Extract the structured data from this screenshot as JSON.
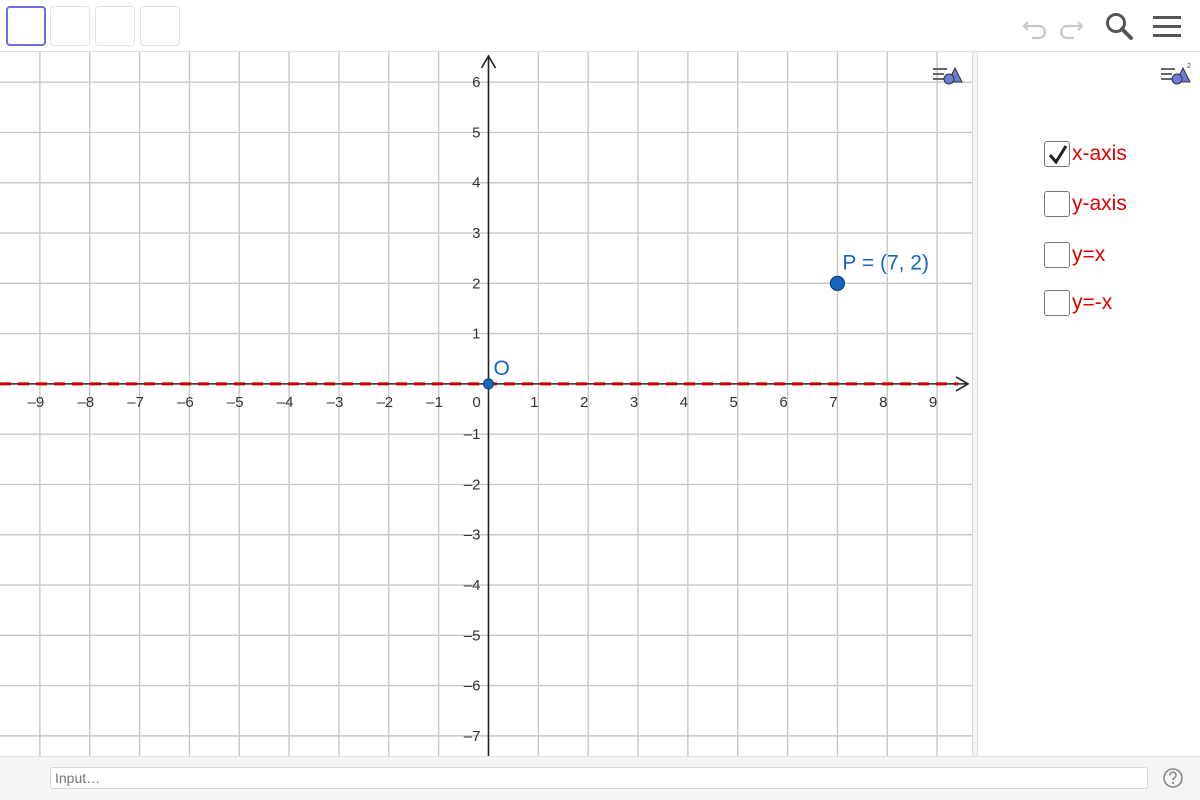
{
  "toolbar": {
    "tool_buttons": [
      {
        "name": "move-tool",
        "selected": true
      },
      {
        "name": "point-tool",
        "selected": false
      },
      {
        "name": "line-tool",
        "selected": false
      },
      {
        "name": "polygon-tool",
        "selected": false
      }
    ],
    "icons": [
      "undo-icon",
      "redo-icon",
      "search-icon",
      "menu-icon"
    ]
  },
  "graphics": {
    "x_ticks": [
      "–9",
      "–8",
      "–7",
      "–6",
      "–5",
      "–4",
      "–3",
      "–2",
      "–1",
      "0",
      "1",
      "2",
      "3",
      "4",
      "5",
      "6",
      "7",
      "8",
      "9"
    ],
    "y_ticks_positive": [
      "1",
      "2",
      "3",
      "4",
      "5",
      "6"
    ],
    "y_ticks_negative": [
      "–1",
      "–2",
      "–3",
      "–4",
      "–5",
      "–6",
      "–7"
    ],
    "x_range": [
      -9.8,
      9.7
    ],
    "y_range": [
      -7.4,
      6.6
    ],
    "grid": true,
    "origin": {
      "label": "O",
      "x": 0,
      "y": 0
    },
    "point_p": {
      "label": "P = (7, 2)",
      "x": 7,
      "y": 2
    },
    "dashed_line": {
      "equation": "y = 0",
      "color": "#cc0000"
    },
    "point_color": "#1565c0",
    "label_color": "#1565c0"
  },
  "panel": {
    "checkboxes": [
      {
        "label": "x-axis",
        "checked": true
      },
      {
        "label": "y-axis",
        "checked": false
      },
      {
        "label": "y=x",
        "checked": false
      },
      {
        "label": "y=-x",
        "checked": false
      }
    ],
    "label_color": "#e00000"
  },
  "inputbar": {
    "placeholder": "Input…",
    "help_icon": "help-icon"
  }
}
